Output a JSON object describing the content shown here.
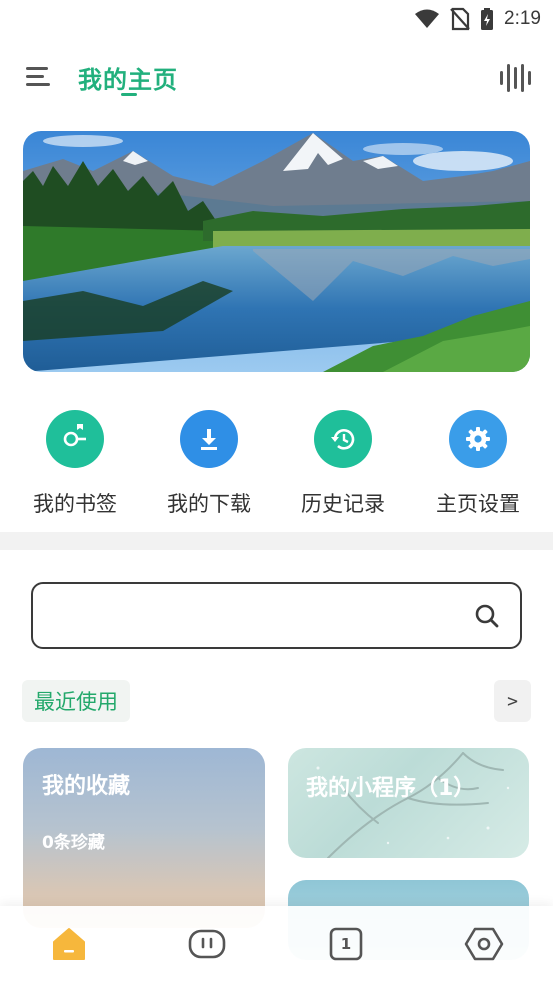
{
  "status_bar": {
    "time": "2:19"
  },
  "app_bar": {
    "title": "我的主页"
  },
  "quick_actions": [
    {
      "label": "我的书签",
      "icon": "bookmark-key-icon",
      "color": "#1fbf9a"
    },
    {
      "label": "我的下载",
      "icon": "download-icon",
      "color": "#2f8fe6"
    },
    {
      "label": "历史记录",
      "icon": "history-icon",
      "color": "#1fbf9a"
    },
    {
      "label": "主页设置",
      "icon": "gear-icon",
      "color": "#3a9de9"
    }
  ],
  "search": {
    "value": "",
    "placeholder": ""
  },
  "recent": {
    "label": "最近使用",
    "more_label": ">"
  },
  "cards": {
    "favorites": {
      "title": "我的收藏",
      "subtitle": "0条珍藏"
    },
    "mini_programs": {
      "title": "我的小程序（1）"
    }
  },
  "bottom_nav": {
    "items": [
      {
        "icon": "home-icon",
        "active": true
      },
      {
        "icon": "chat-bubble-icon",
        "active": false
      },
      {
        "icon": "tabs-count-icon",
        "count": "1",
        "active": false
      },
      {
        "icon": "hexagon-settings-icon",
        "active": false
      }
    ]
  },
  "colors": {
    "accent": "#22b07d",
    "home_active": "#f6b73c"
  }
}
